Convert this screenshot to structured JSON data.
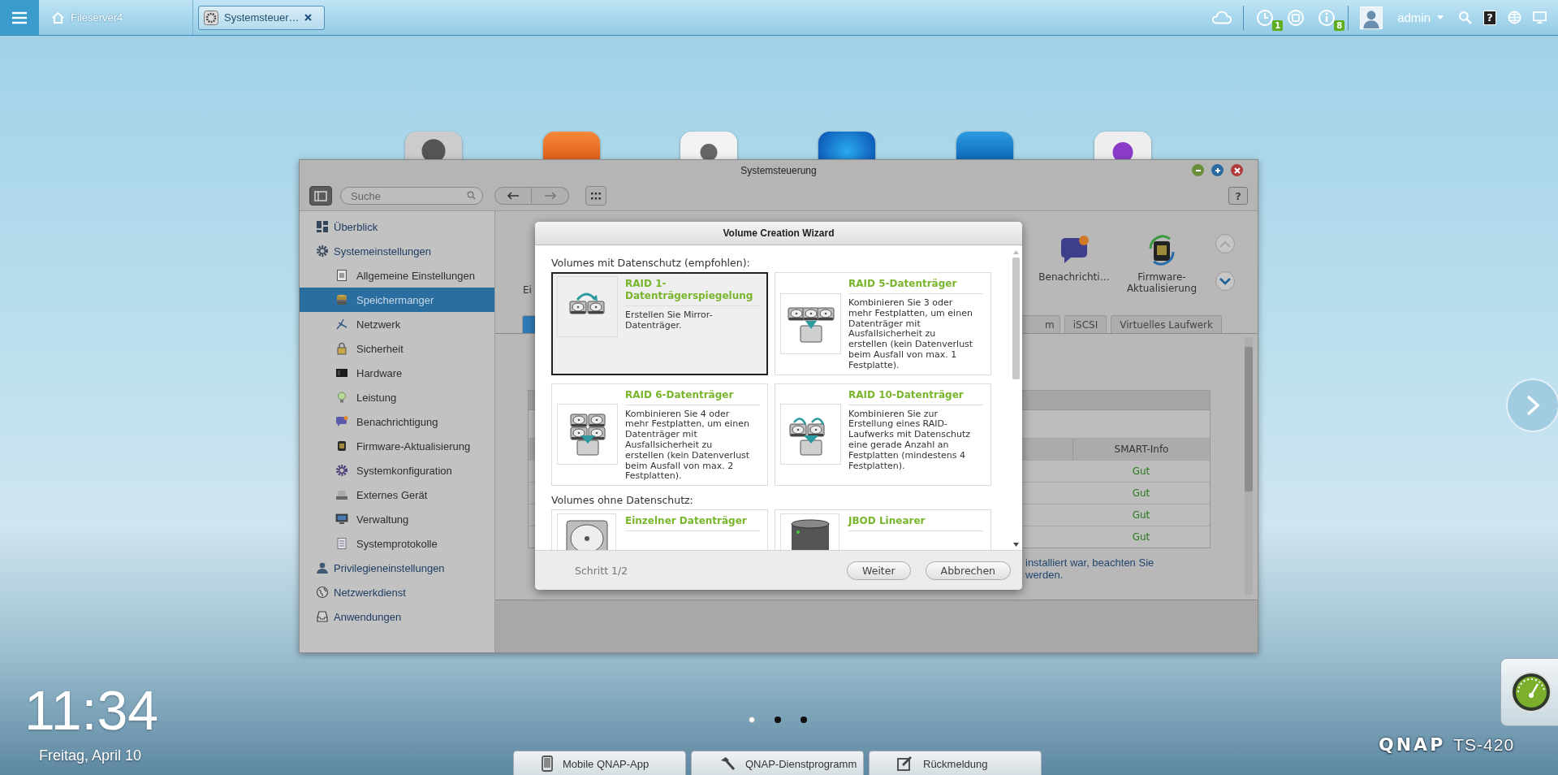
{
  "top_bar": {
    "home_label": "Fileserver4",
    "open_tabs": [
      {
        "label": "Systemsteuer…",
        "selected": true
      }
    ],
    "badges": [
      "1",
      "8"
    ],
    "user": "admin",
    "help": "?"
  },
  "window": {
    "title": "Systemsteuerung",
    "help": "?",
    "search": {
      "placeholder": "Suche"
    },
    "sidebar": [
      {
        "label": "Überblick",
        "selected": false
      },
      {
        "label": "Systemeinstellungen",
        "selected": false,
        "children": [
          {
            "label": "Allgemeine Einstellungen",
            "selected": false
          },
          {
            "label": "Speichermanger",
            "selected": true
          },
          {
            "label": "Netzwerk",
            "selected": false
          },
          {
            "label": "Sicherheit",
            "selected": false
          },
          {
            "label": "Hardware",
            "selected": false
          },
          {
            "label": "Leistung",
            "selected": false
          },
          {
            "label": "Benachrichtigung",
            "selected": false
          },
          {
            "label": "Firmware-Aktualisierung",
            "selected": false
          },
          {
            "label": "Systemkonfiguration",
            "selected": false
          },
          {
            "label": "Externes Gerät",
            "selected": false
          },
          {
            "label": "Verwaltung",
            "selected": false
          },
          {
            "label": "Systemprotokolle",
            "selected": false
          }
        ]
      },
      {
        "label": "Privilegieneinstellungen",
        "selected": false
      },
      {
        "label": "Netzwerkdienst",
        "selected": false
      },
      {
        "label": "Anwendungen",
        "selected": false
      }
    ],
    "content": {
      "cut_label": "Ei",
      "shortcuts": [
        "Benachrichti…",
        "Firmware-Aktualisierung"
      ],
      "tabs": [
        {
          "selected": true
        },
        {
          "label": "m",
          "selected": false
        },
        {
          "label": "iSCSI",
          "selected": false
        },
        {
          "label": "Virtuelles Laufwerk",
          "selected": false
        }
      ],
      "table": {
        "columns": [
          "SMART-Info"
        ],
        "rows": [
          {
            "smart_info": "Gut"
          },
          {
            "smart_info": "Gut"
          },
          {
            "smart_info": "Gut"
          },
          {
            "smart_info": "Gut"
          }
        ]
      },
      "note_lines": [
        "installiert war, beachten Sie",
        "werden."
      ]
    }
  },
  "wizard": {
    "title": "Volume Creation Wizard",
    "sections": [
      {
        "heading": "Volumes mit Datenschutz (empfohlen):",
        "options": [
          {
            "title": "RAID 1-Datenträgerspiegelung",
            "description": "Erstellen Sie Mirror-Datenträger.",
            "selected": true
          },
          {
            "title": "RAID 5-Datenträger",
            "description": "Kombinieren Sie 3 oder mehr Festplatten, um einen Datenträger mit Ausfallsicherheit zu erstellen (kein Datenverlust beim Ausfall von max. 1 Festplatte).",
            "selected": false
          },
          {
            "title": "RAID 6-Datenträger",
            "description": "Kombinieren Sie 4 oder mehr Festplatten, um einen Datenträger mit Ausfallsicherheit zu erstellen (kein Datenverlust beim Ausfall von max. 2 Festplatten).",
            "selected": false
          },
          {
            "title": "RAID 10-Datenträger",
            "description": "Kombinieren Sie zur Erstellung eines RAID-Laufwerks mit Datenschutz eine gerade Anzahl an Festplatten (mindestens 4 Festplatten).",
            "selected": false
          }
        ]
      },
      {
        "heading": "Volumes ohne Datenschutz:",
        "options": [
          {
            "title": "Einzelner Datenträger",
            "selected": false
          },
          {
            "title": "JBOD Linearer",
            "selected": false
          }
        ]
      }
    ],
    "step": "Schritt 1/2",
    "buttons": [
      "Weiter",
      "Abbrechen"
    ]
  },
  "desktop": {
    "clock": "11:34",
    "date": "Freitag, April 10",
    "pages": [
      {
        "selected": true
      },
      {
        "selected": false
      },
      {
        "selected": false
      }
    ],
    "dock": [
      "Mobile QNAP-App",
      "QNAP-Dienstprogramm",
      "Rückmeldung"
    ],
    "brand": "QNAP",
    "model": "TS-420"
  }
}
